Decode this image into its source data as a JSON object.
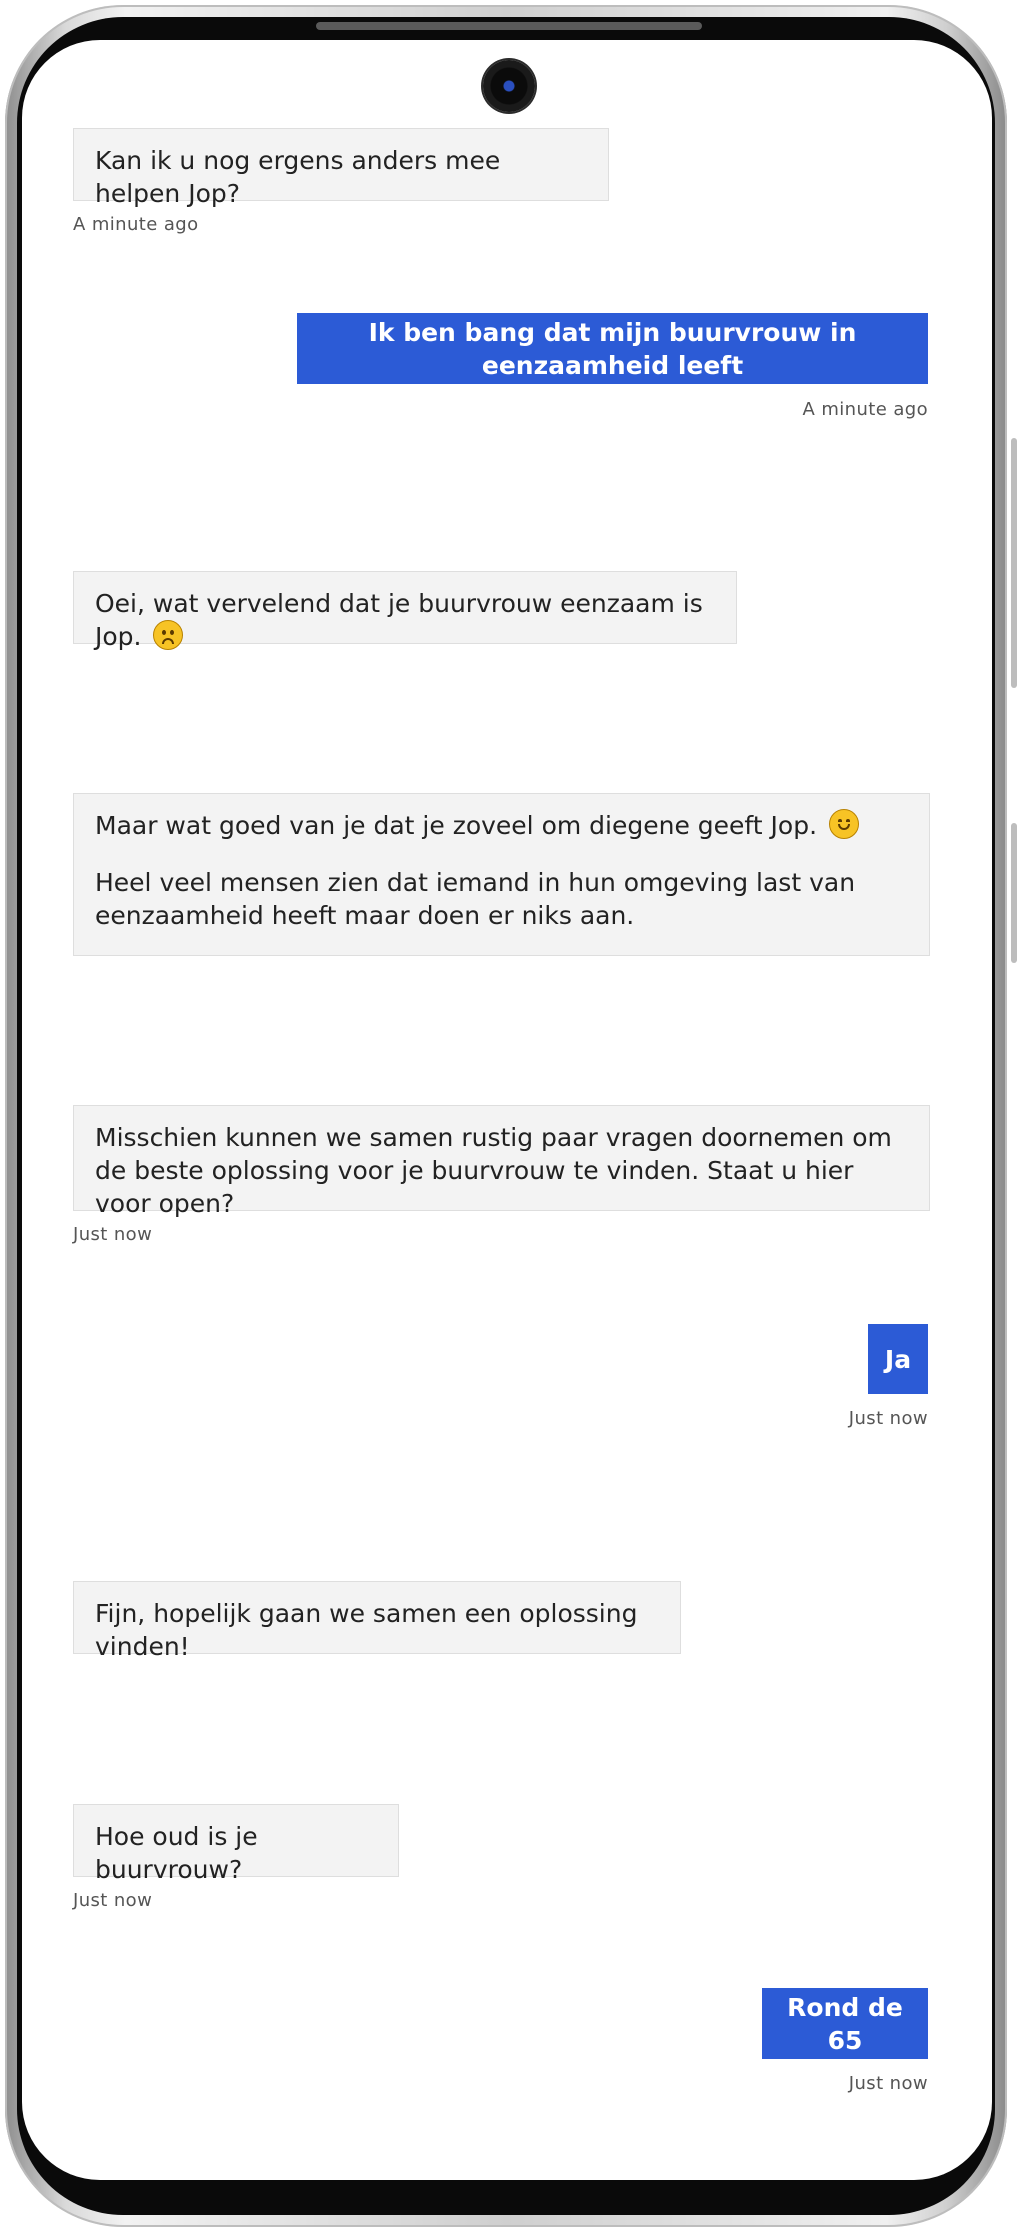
{
  "chat": {
    "messages": [
      {
        "sender": "bot",
        "text": "Kan ik u nog ergens anders mee helpen Jop?",
        "timestamp": "A minute ago"
      },
      {
        "sender": "user",
        "text": "Ik ben bang dat mijn buurvrouw in eenzaamheid leeft",
        "timestamp": "A minute ago"
      },
      {
        "sender": "bot",
        "text": "Oei, wat vervelend dat je buurvrouw eenzaam is Jop.",
        "emoji": "frowning-face"
      },
      {
        "sender": "bot",
        "line1": "Maar wat goed van je dat je zoveel om diegene geeft Jop.",
        "emoji": "smiling-face",
        "line2": "Heel veel mensen zien dat iemand in hun omgeving last van eenzaamheid heeft maar doen er niks aan."
      },
      {
        "sender": "bot",
        "text": "Misschien kunnen we samen rustig paar vragen doornemen om de beste oplossing voor je buurvrouw te vinden. Staat u hier voor open?",
        "timestamp": "Just now"
      },
      {
        "sender": "user",
        "text": "Ja",
        "timestamp": "Just now"
      },
      {
        "sender": "bot",
        "text": "Fijn, hopelijk gaan we samen een oplossing vinden!"
      },
      {
        "sender": "bot",
        "text": "Hoe oud is je buurvrouw?",
        "timestamp": "Just now"
      },
      {
        "sender": "user",
        "text": "Rond de 65",
        "timestamp": "Just now"
      }
    ]
  },
  "colors": {
    "user_bubble": "#2c5bd6",
    "bot_bubble": "#f3f3f3"
  }
}
